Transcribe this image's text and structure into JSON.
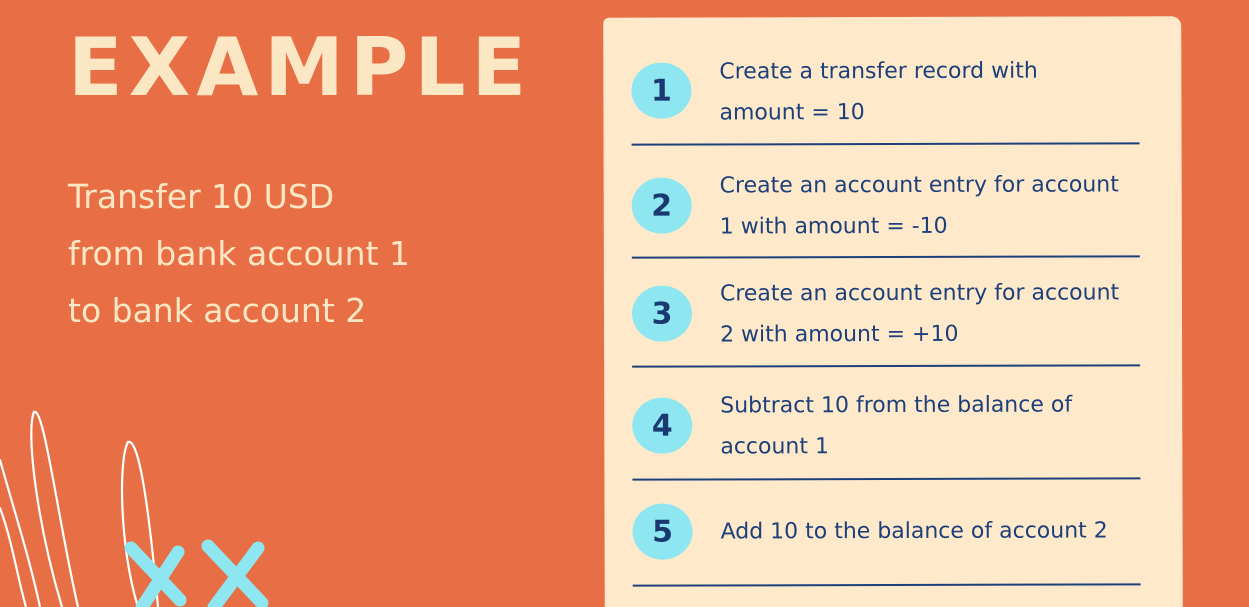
{
  "title": "EXAMPLE",
  "subtitle_lines": [
    "Transfer 10 USD",
    "from bank account 1",
    "to bank account 2"
  ],
  "steps": [
    {
      "number": "1",
      "text": "Create a transfer record with amount = 10"
    },
    {
      "number": "2",
      "text": "Create an account entry for account 1 with amount = -10"
    },
    {
      "number": "3",
      "text": "Create an account entry for account 2 with amount = +10"
    },
    {
      "number": "4",
      "text": "Subtract 10 from the balance of account 1"
    },
    {
      "number": "5",
      "text": "Add 10 to the balance of account 2"
    }
  ],
  "colors": {
    "background": "#E86F45",
    "title_text": "#FCE7C4",
    "card": "#FEEACB",
    "badge": "#8EE6F1",
    "step_text": "#1D3F7A"
  },
  "decoration": {
    "doodle_icon": "white-loops-icon",
    "crosses_icon": "blue-x-marks-icon"
  }
}
